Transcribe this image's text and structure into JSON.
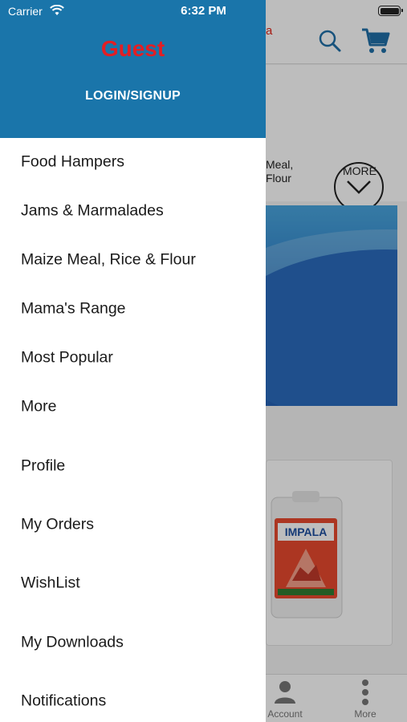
{
  "status_bar": {
    "carrier": "Carrier",
    "time": "6:32 PM"
  },
  "drawer": {
    "user_name": "Guest",
    "login_label": "LOGIN/SIGNUP",
    "categories": [
      {
        "label": "Food Hampers"
      },
      {
        "label": "Jams & Marmalades"
      },
      {
        "label": "Maize Meal, Rice & Flour"
      },
      {
        "label": "Mama's Range"
      },
      {
        "label": "Most Popular"
      },
      {
        "label": "More"
      }
    ],
    "account_items": [
      {
        "label": "Profile"
      },
      {
        "label": "My Orders"
      },
      {
        "label": "WishList"
      },
      {
        "label": "My Downloads"
      },
      {
        "label": "Notifications"
      }
    ]
  },
  "background": {
    "logo_fragment": "a",
    "category_fragment_1": "Meal,",
    "category_fragment_2": "Flour",
    "more_category": "MORE",
    "product_brand": "IMPALA",
    "tabs": {
      "account": "Account",
      "more": "More"
    }
  },
  "colors": {
    "drawer_header": "#1a75aa",
    "guest_name": "#e31e24",
    "menu_text": "#1a1a1a",
    "accent_blue": "#1f6fa8"
  }
}
